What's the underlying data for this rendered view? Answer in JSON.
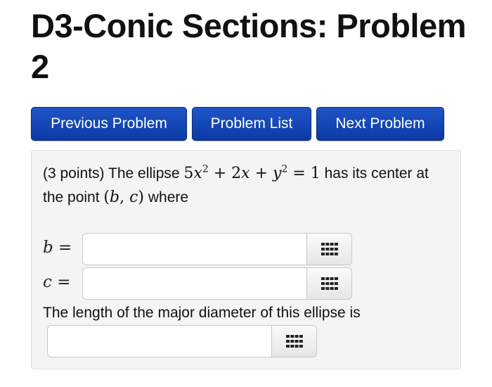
{
  "page": {
    "title": "D3-Conic Sections: Problem 2"
  },
  "nav": {
    "previous_label": "Previous Problem",
    "list_label": "Problem List",
    "next_label": "Next Problem"
  },
  "problem": {
    "points_text": "(3 points) The ellipse ",
    "equation": {
      "a": "5",
      "b": "x",
      "sup1": "2",
      "plus1": " + 2",
      "c": "x",
      "plus2": " + ",
      "d": "y",
      "sup2": "2",
      "rest": " = 1"
    },
    "text_after_equation": " has its center at the point ",
    "point": {
      "open": "(",
      "b": "b",
      "comma": ", ",
      "c": "c",
      "close": ")"
    },
    "text_where": " where",
    "answers": [
      {
        "var": "b",
        "eq": " =",
        "value": "",
        "placeholder": ""
      },
      {
        "var": "c",
        "eq": " =",
        "value": "",
        "placeholder": ""
      }
    ],
    "major_prompt": "The length of the major diameter of this ellipse is",
    "major_answer": {
      "value": "",
      "placeholder": ""
    },
    "keypad_icon": "keypad-grid-icon"
  }
}
